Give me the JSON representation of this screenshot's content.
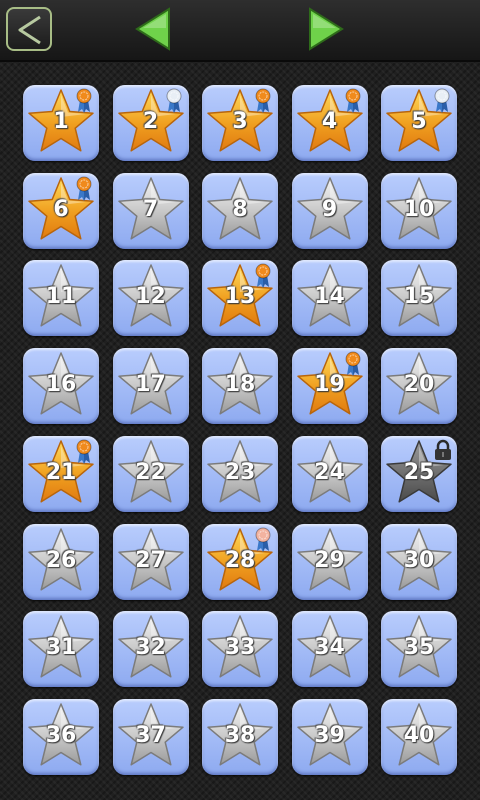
{
  "colors": {
    "arrow_green": "#6fd24a",
    "tile_blue": "#a3bbf8",
    "star_gold": "#f5a623",
    "star_silver": "#c8c8c8",
    "star_dark": "#7a7a7a",
    "badge_orange": "#f08a1c",
    "badge_white": "#e8eef5",
    "badge_pink": "#f2b3a0"
  },
  "header": {
    "back_icon": "back-arrow-icon",
    "prev_icon": "triangle-left-icon",
    "next_icon": "triangle-right-icon"
  },
  "levels": [
    {
      "number": "1",
      "star": "gold",
      "badge": "orange"
    },
    {
      "number": "2",
      "star": "gold",
      "badge": "white"
    },
    {
      "number": "3",
      "star": "gold",
      "badge": "orange"
    },
    {
      "number": "4",
      "star": "gold",
      "badge": "orange"
    },
    {
      "number": "5",
      "star": "gold",
      "badge": "white"
    },
    {
      "number": "6",
      "star": "gold",
      "badge": "orange"
    },
    {
      "number": "7",
      "star": "silver",
      "badge": ""
    },
    {
      "number": "8",
      "star": "silver",
      "badge": ""
    },
    {
      "number": "9",
      "star": "silver",
      "badge": ""
    },
    {
      "number": "10",
      "star": "silver",
      "badge": ""
    },
    {
      "number": "11",
      "star": "silver",
      "badge": ""
    },
    {
      "number": "12",
      "star": "silver",
      "badge": ""
    },
    {
      "number": "13",
      "star": "gold",
      "badge": "orange"
    },
    {
      "number": "14",
      "star": "silver",
      "badge": ""
    },
    {
      "number": "15",
      "star": "silver",
      "badge": ""
    },
    {
      "number": "16",
      "star": "silver",
      "badge": ""
    },
    {
      "number": "17",
      "star": "silver",
      "badge": ""
    },
    {
      "number": "18",
      "star": "silver",
      "badge": ""
    },
    {
      "number": "19",
      "star": "gold",
      "badge": "orange"
    },
    {
      "number": "20",
      "star": "silver",
      "badge": ""
    },
    {
      "number": "21",
      "star": "gold",
      "badge": "orange"
    },
    {
      "number": "22",
      "star": "silver",
      "badge": ""
    },
    {
      "number": "23",
      "star": "silver",
      "badge": ""
    },
    {
      "number": "24",
      "star": "silver",
      "badge": ""
    },
    {
      "number": "25",
      "star": "dark",
      "badge": "",
      "locked": true
    },
    {
      "number": "26",
      "star": "silver",
      "badge": ""
    },
    {
      "number": "27",
      "star": "silver",
      "badge": ""
    },
    {
      "number": "28",
      "star": "gold",
      "badge": "pink"
    },
    {
      "number": "29",
      "star": "silver",
      "badge": ""
    },
    {
      "number": "30",
      "star": "silver",
      "badge": ""
    },
    {
      "number": "31",
      "star": "silver",
      "badge": ""
    },
    {
      "number": "32",
      "star": "silver",
      "badge": ""
    },
    {
      "number": "33",
      "star": "silver",
      "badge": ""
    },
    {
      "number": "34",
      "star": "silver",
      "badge": ""
    },
    {
      "number": "35",
      "star": "silver",
      "badge": ""
    },
    {
      "number": "36",
      "star": "silver",
      "badge": ""
    },
    {
      "number": "37",
      "star": "silver",
      "badge": ""
    },
    {
      "number": "38",
      "star": "silver",
      "badge": ""
    },
    {
      "number": "39",
      "star": "silver",
      "badge": ""
    },
    {
      "number": "40",
      "star": "silver",
      "badge": ""
    }
  ]
}
